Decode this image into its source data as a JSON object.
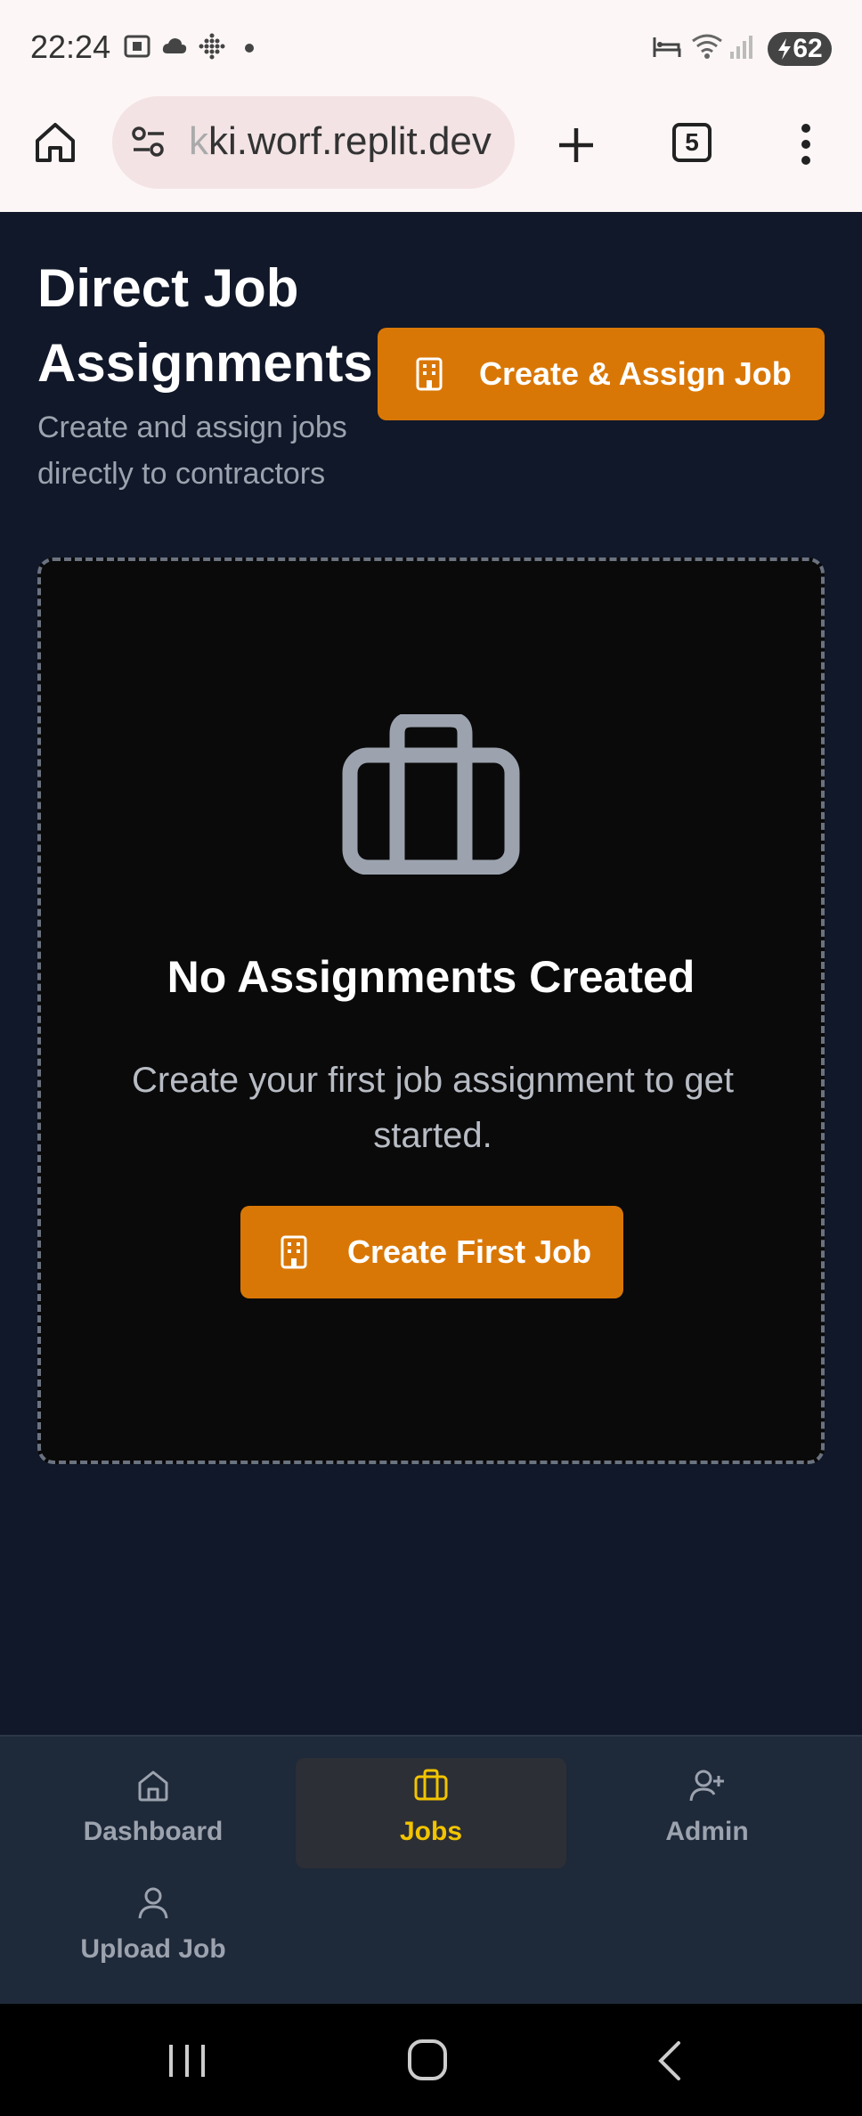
{
  "status_bar": {
    "time": "22:24",
    "battery": "62"
  },
  "browser": {
    "url_visible": "ki.worf.replit.dev",
    "url_fade": "k",
    "tab_count": "5"
  },
  "page": {
    "title": "Direct Job Assignments",
    "subtitle": "Create and assign jobs directly to contractors",
    "create_assign_label": "Create & Assign Job",
    "empty_state": {
      "icon": "briefcase-icon",
      "title": "No Assignments Created",
      "description": "Create your first job assignment to get started.",
      "button_label": "Create First Job"
    }
  },
  "bottom_nav": {
    "items": [
      {
        "label": "Dashboard",
        "icon": "home-icon",
        "active": false
      },
      {
        "label": "Jobs",
        "icon": "briefcase-icon",
        "active": true
      },
      {
        "label": "Admin",
        "icon": "user-plus-icon",
        "active": false
      },
      {
        "label": "Upload Job",
        "icon": "user-icon",
        "active": false
      }
    ]
  },
  "colors": {
    "accent": "#d97706",
    "active_nav": "#f2c400",
    "background": "#111829"
  }
}
